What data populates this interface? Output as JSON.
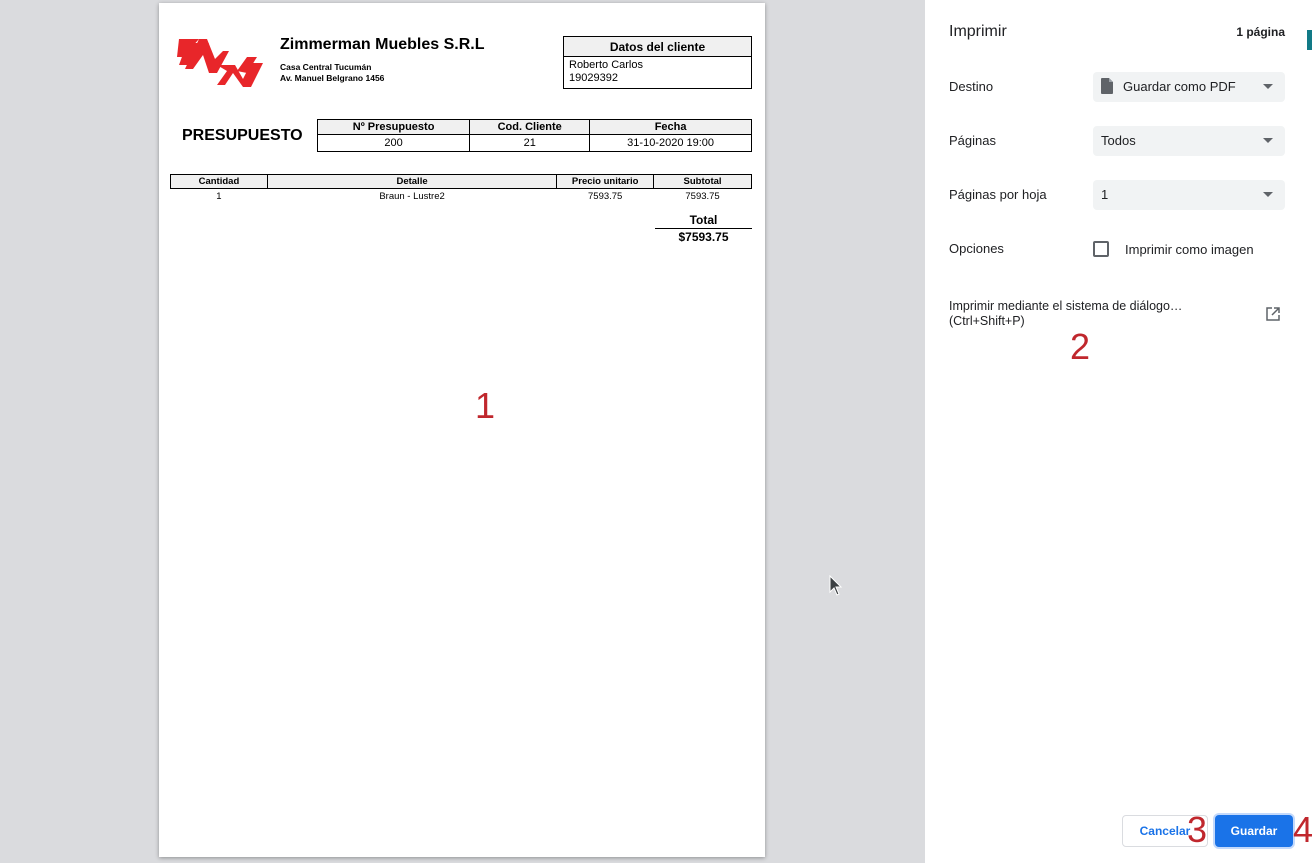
{
  "document": {
    "company_name": "Zimmerman Muebles S.R.L",
    "address_line1": "Casa Central Tucumán",
    "address_line2": "Av. Manuel Belgrano 1456",
    "client_header": "Datos del cliente",
    "client_name": "Roberto Carlos",
    "client_id": "19029392",
    "title": "PRESUPUESTO",
    "meta_headers": [
      "Nº Presupuesto",
      "Cod. Cliente",
      "Fecha"
    ],
    "meta_values": [
      "200",
      "21",
      "31-10-2020 19:00"
    ],
    "item_headers": [
      "Cantidad",
      "Detalle",
      "Precio unitario",
      "Subtotal"
    ],
    "items": [
      {
        "cantidad": "1",
        "detalle": "Braun - Lustre2",
        "precio": "7593.75",
        "subtotal": "7593.75"
      }
    ],
    "total_label": "Total",
    "total_value": "$7593.75"
  },
  "annotations": [
    "1",
    "2",
    "3",
    "4"
  ],
  "print_panel": {
    "title": "Imprimir",
    "page_count": "1 página",
    "destination_label": "Destino",
    "destination_value": "Guardar como PDF",
    "pages_label": "Páginas",
    "pages_value": "Todos",
    "pages_per_sheet_label": "Páginas por hoja",
    "pages_per_sheet_value": "1",
    "options_label": "Opciones",
    "print_as_image_label": "Imprimir como imagen",
    "print_as_image_checked": false,
    "system_dialog_line1": "Imprimir mediante el sistema de diálogo…",
    "system_dialog_line2": "(Ctrl+Shift+P)",
    "cancel_label": "Cancelar",
    "save_label": "Guardar"
  },
  "colors": {
    "accent": "#1a73e8",
    "logo": "#e8262a",
    "annotation": "#c0272d",
    "preview_bg": "#dadbde"
  },
  "icons": [
    "file-icon",
    "dropdown-caret-icon",
    "external-link-icon",
    "mouse-cursor-icon",
    "company-logo"
  ]
}
